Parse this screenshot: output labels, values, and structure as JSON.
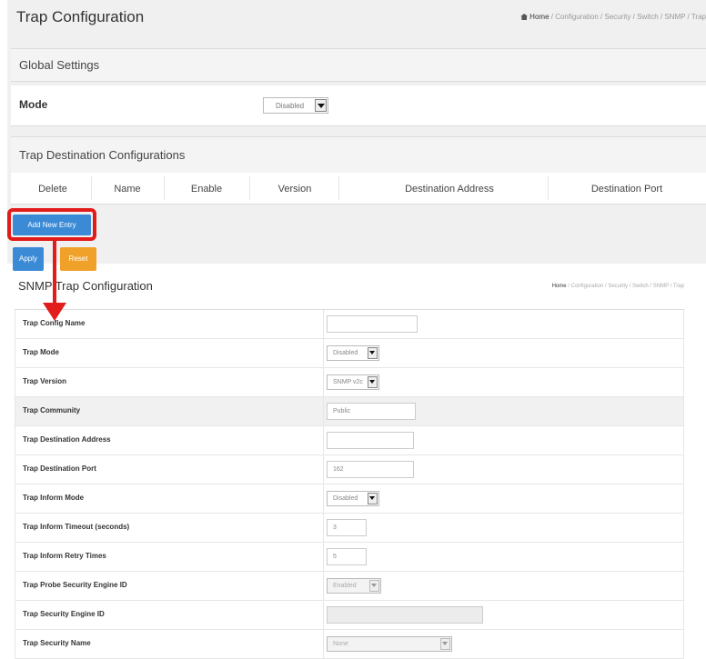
{
  "header": {
    "title": "Trap Configuration",
    "breadcrumb": [
      "Home",
      "Configuration",
      "Security",
      "Switch",
      "SNMP",
      "Trap"
    ]
  },
  "global_settings": {
    "title": "Global Settings",
    "mode_label": "Mode",
    "mode_value": "Disabled"
  },
  "trap_destinations": {
    "title": "Trap Destination Configurations",
    "columns": [
      "Delete",
      "Name",
      "Enable",
      "Version",
      "Destination Address",
      "Destination Port"
    ]
  },
  "buttons": {
    "add_new_entry": "Add New Entry",
    "apply": "Apply",
    "reset": "Reset"
  },
  "snmp_trap": {
    "title": "SNMP Trap Configuration",
    "breadcrumb": [
      "Home",
      "Configuration",
      "Security",
      "Switch",
      "SNMP",
      "Trap"
    ],
    "rows": [
      {
        "label": "Trap Config Name",
        "type": "text",
        "value": ""
      },
      {
        "label": "Trap Mode",
        "type": "select",
        "value": "Disabled"
      },
      {
        "label": "Trap Version",
        "type": "select",
        "value": "SNMP v2c"
      },
      {
        "label": "Trap Community",
        "type": "text",
        "value": "Public"
      },
      {
        "label": "Trap Destination Address",
        "type": "text",
        "value": ""
      },
      {
        "label": "Trap Destination Port",
        "type": "text",
        "value": "162"
      },
      {
        "label": "Trap Inform Mode",
        "type": "select",
        "value": "Disabled"
      },
      {
        "label": "Trap Inform Timeout (seconds)",
        "type": "text",
        "value": "3"
      },
      {
        "label": "Trap Inform Retry Times",
        "type": "text",
        "value": "5"
      },
      {
        "label": "Trap Probe Security Engine ID",
        "type": "select",
        "value": "Enabled"
      },
      {
        "label": "Trap Security Engine ID",
        "type": "text",
        "value": ""
      },
      {
        "label": "Trap Security Name",
        "type": "select",
        "value": "None"
      }
    ]
  },
  "annotation": {
    "highlight_color": "#e21b1b"
  }
}
